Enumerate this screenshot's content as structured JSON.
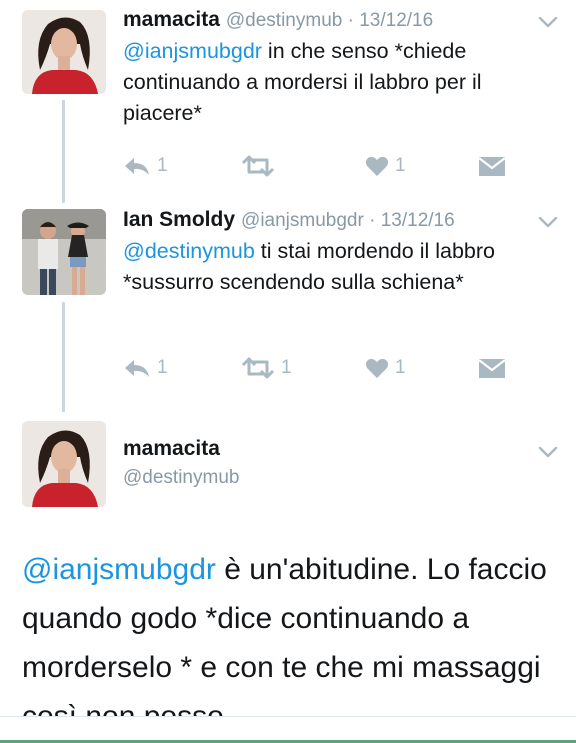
{
  "tweets": [
    {
      "name": "mamacita",
      "handle": "@destinymub",
      "date": "13/12/16",
      "mention": "@ianjsmubgdr",
      "text": " in che senso *chiede continuando a mordersi il labbro per il piacere*",
      "reply_count": "1",
      "retweet_count": "",
      "like_count": "1"
    },
    {
      "name": "Ian Smoldy",
      "handle": "@ianjsmubgdr",
      "date": "13/12/16",
      "mention": "@destinymub",
      "text": " ti stai mordendo il labbro *sussurro scendendo sulla schiena*",
      "reply_count": "1",
      "retweet_count": "1",
      "like_count": "1"
    }
  ],
  "focus_tweet": {
    "name": "mamacita",
    "handle": "@destinymub",
    "mention": "@ianjsmubgdr",
    "text": " è un'abitudine. Lo faccio quando godo *dice continuando a morderselo * e con te che mi massaggi così non posso"
  },
  "colors": {
    "accent": "#1b95e0",
    "muted": "#8899a6",
    "icon": "#aab8c2",
    "thread_line": "#ccd6dd"
  },
  "icons": [
    "reply-icon",
    "retweet-icon",
    "like-icon",
    "direct-message-icon",
    "chevron-down-icon"
  ]
}
